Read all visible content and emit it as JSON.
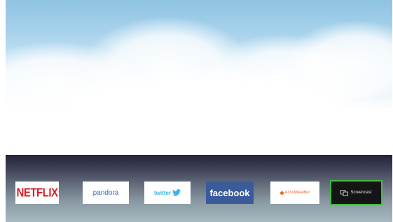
{
  "launcher": {
    "apps": [
      {
        "label": "NETFLIX",
        "brand_color": "#d81f26",
        "background": "#ffffff"
      },
      {
        "label": "pandora",
        "brand_color": "#3f6fb5",
        "background": "#ffffff"
      },
      {
        "label": "twitter",
        "brand_color": "#33b7ec",
        "background": "#ffffff",
        "icon": "twitter-bird-icon"
      },
      {
        "label": "facebook",
        "brand_color": "#ffffff",
        "background": "#3b5a9a"
      },
      {
        "label": "AccuWeather",
        "brand_color": "#f26522",
        "background": "#ffffff",
        "icon": "sun-icon"
      },
      {
        "label": "Screencast",
        "brand_color": "#e6e6e6",
        "background": "#151515",
        "icon": "screencast-icon",
        "focused": true,
        "focus_color": "#45b84a"
      }
    ]
  }
}
